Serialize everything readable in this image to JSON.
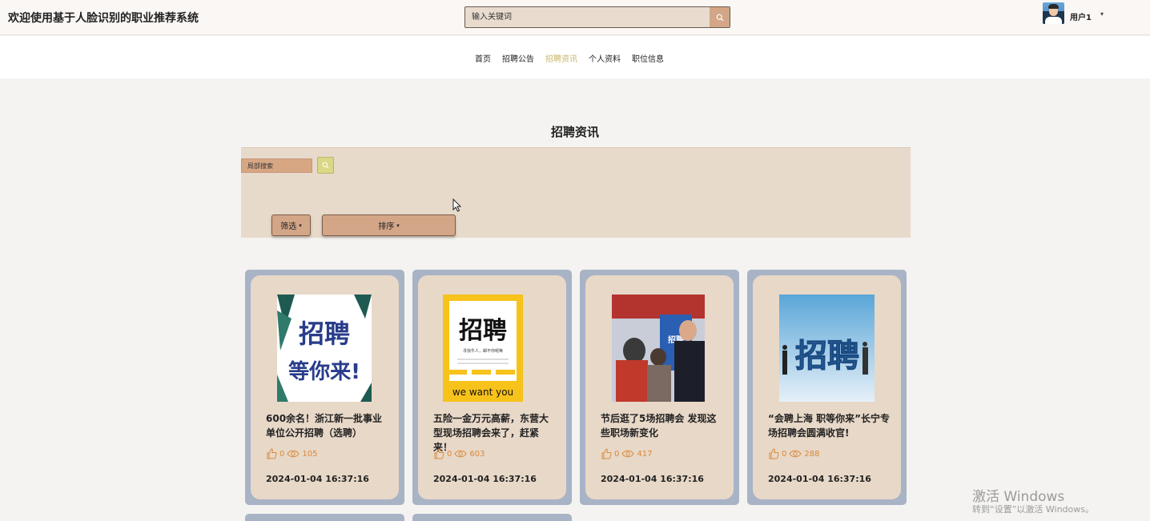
{
  "header": {
    "site_title": "欢迎使用基于人脸识别的职业推荐系统",
    "search_placeholder": "输入关键词",
    "user_name": "用户1"
  },
  "nav": {
    "items": [
      {
        "label": "首页",
        "active": false
      },
      {
        "label": "招聘公告",
        "active": false
      },
      {
        "label": "招聘资讯",
        "active": true
      },
      {
        "label": "个人资料",
        "active": false
      },
      {
        "label": "职位信息",
        "active": false
      }
    ]
  },
  "section": {
    "title": "招聘资讯",
    "local_search_placeholder": "局部搜索",
    "filter_label": "筛选",
    "sort_label": "排序"
  },
  "cards": [
    {
      "title": "600余名！浙江新一批事业单位公开招聘（选聘）",
      "likes": "0",
      "views": "105",
      "date": "2024-01-04 16:37:16",
      "image": "recruit-poster-wait-for-you"
    },
    {
      "title": "五险一金万元高薪，东营大型现场招聘会来了，赶紧来！",
      "likes": "0",
      "views": "603",
      "date": "2024-01-04 16:37:16",
      "image": "recruit-poster-we-want-you"
    },
    {
      "title": "节后逛了5场招聘会 发现这些职场新变化",
      "likes": "0",
      "views": "417",
      "date": "2024-01-04 16:37:16",
      "image": "job-fair-photo"
    },
    {
      "title": "“会聘上海 职等你来”长宁专场招聘会圆满收官!",
      "likes": "0",
      "views": "288",
      "date": "2024-01-04 16:37:16",
      "image": "recruit-3d-text-with-people"
    }
  ],
  "watermark": {
    "line1": "激活 Windows",
    "line2": "转到“设置”以激活 Windows。"
  },
  "colors": {
    "nav_active": "#c7b56a",
    "card_border": "#a8b3c6",
    "card_bg": "#e8d8c8",
    "accent": "#d3a687",
    "stats": "#d98a3a"
  }
}
